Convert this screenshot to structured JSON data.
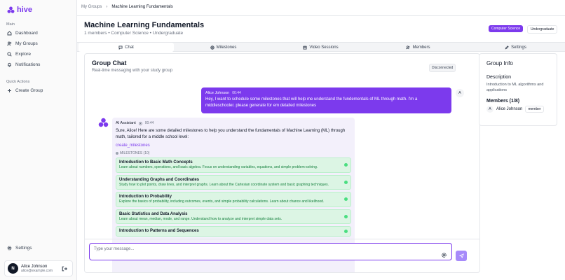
{
  "app": {
    "name": "hive"
  },
  "sidebar": {
    "main_label": "Main",
    "main_items": [
      {
        "label": "Dashboard",
        "icon": "home-icon"
      },
      {
        "label": "My Groups",
        "icon": "users-icon"
      },
      {
        "label": "Explore",
        "icon": "search-icon"
      },
      {
        "label": "Notifications",
        "icon": "bell-icon"
      }
    ],
    "quick_label": "Quick Actions",
    "quick_items": [
      {
        "label": "Create Group",
        "icon": "plus-icon"
      }
    ],
    "settings_label": "Settings",
    "user": {
      "initial": "N",
      "name": "Alice Johnson",
      "email": "alice@example.com"
    }
  },
  "breadcrumb": {
    "parent": "My Groups",
    "current": "Machine Learning Fundamentals"
  },
  "header": {
    "title": "Machine Learning Fundamentals",
    "subtitle": "1 members • Computer Science • Undergraduate",
    "badge_subject": "Computer Science",
    "badge_level": "Undergraduate"
  },
  "tabs": [
    {
      "label": "Chat",
      "icon": "chat-icon",
      "active": true
    },
    {
      "label": "Milestones",
      "icon": "target-icon"
    },
    {
      "label": "Video Sessions",
      "icon": "calendar-icon"
    },
    {
      "label": "Members",
      "icon": "users-icon"
    },
    {
      "label": "Settings",
      "icon": "pencil-icon"
    }
  ],
  "chat": {
    "title": "Group Chat",
    "subtitle": "Real-time messaging with your study group",
    "status": "Disconnected",
    "user_message": {
      "author": "Alice Johnson",
      "time": "00:44",
      "avatar": "A",
      "text": "Hey, I want to schedule some milestones that will help me understand the fundementals of ML through math. I'm a middleschooler. please generate for em detailed milestones"
    },
    "ai_message": {
      "author": "AI Assistant",
      "time": "00:44",
      "text": "Sure, Alice! Here are some detailed milestones to help you understand the fundamentals of Machine Learning (ML) through math, tailored for a middle school level:",
      "tool": "create_milestones",
      "milestones_label": "MILESTONES (10)",
      "milestones": [
        {
          "title": "Introduction to Basic Math Concepts",
          "desc": "Learn about numbers, operations, and basic algebra. Focus on understanding variables, equations, and simple problem-solving."
        },
        {
          "title": "Understanding Graphs and Coordinates",
          "desc": "Study how to plot points, draw lines, and interpret graphs. Learn about the Cartesian coordinate system and basic graphing techniques."
        },
        {
          "title": "Introduction to Probability",
          "desc": "Explore the basics of probability, including outcomes, events, and simple probability calculations. Learn about chance and likelihood."
        },
        {
          "title": "Basic Statistics and Data Analysis",
          "desc": "Learn about mean, median, mode, and range. Understand how to analyze and interpret simple data sets."
        },
        {
          "title": "Introduction to Patterns and Sequences",
          "desc": ""
        }
      ]
    },
    "input_placeholder": "Type your message..."
  },
  "group_info": {
    "title": "Group Info",
    "desc_heading": "Description",
    "description": "Introduction to ML algorithms and applications",
    "members_heading": "Members (1/8)",
    "members": [
      {
        "initial": "A",
        "name": "Alice Johnson",
        "role": "member"
      }
    ]
  },
  "colors": {
    "accent": "#7c3aed",
    "milestone_bg": "#dcf5e4",
    "milestone_dot": "#4ade80"
  }
}
